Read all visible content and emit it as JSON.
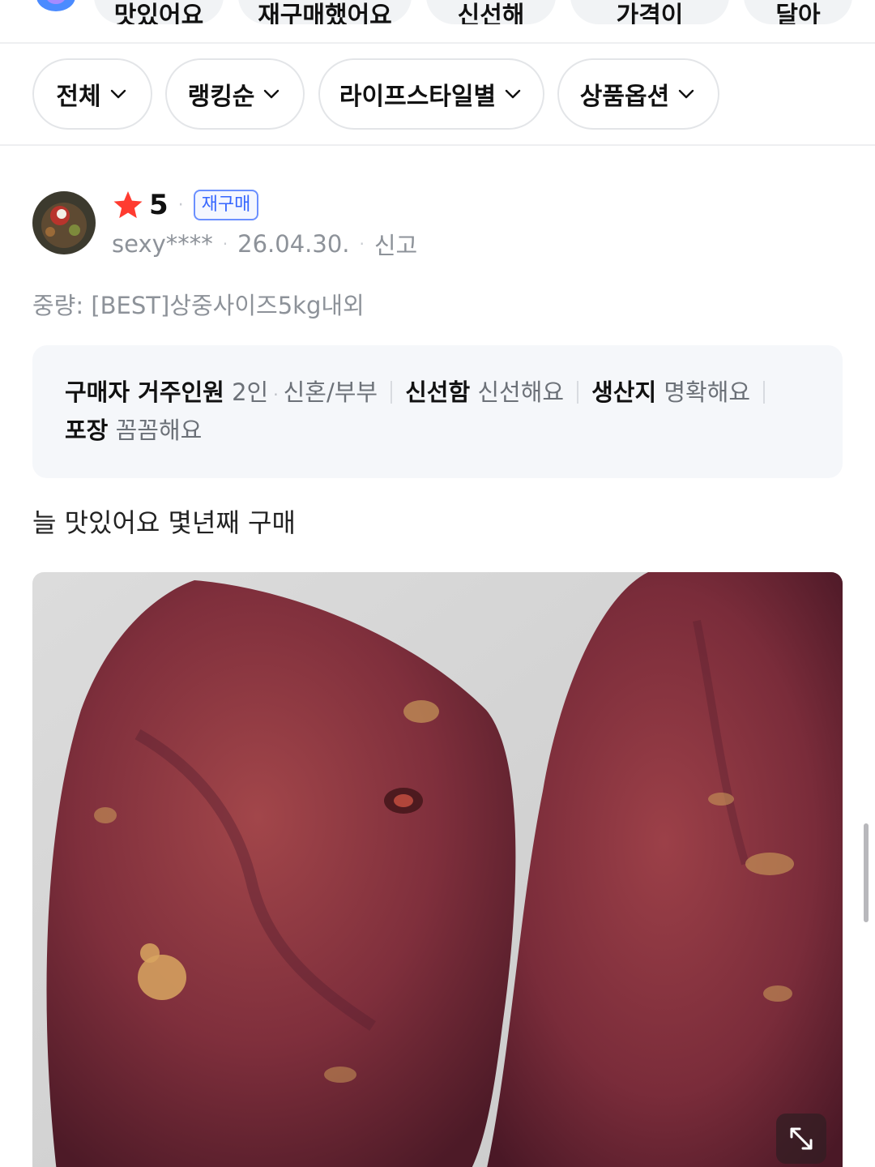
{
  "top_chips": [
    "맛있어요",
    "재구매했어요",
    "신선해",
    "가격이",
    "달아"
  ],
  "filters": [
    {
      "label": "전체"
    },
    {
      "label": "랭킹순"
    },
    {
      "label": "라이프스타일별"
    },
    {
      "label": "상품옵션"
    }
  ],
  "review": {
    "rating": "5",
    "badge": "재구매",
    "user": "sexy****",
    "date": "26.04.30.",
    "report": "신고",
    "option": "중량: [BEST]상중사이즈5kg내외",
    "attributes": {
      "household_label": "구매자 거주인원",
      "household_count": "2인",
      "household_type": "신혼/부부",
      "freshness_label": "신선함",
      "freshness_value": "신선해요",
      "origin_label": "생산지",
      "origin_value": "명확해요",
      "packaging_label": "포장",
      "packaging_value": "꼼꼼해요"
    },
    "text": "늘 맛있어요 몇년째 구매"
  },
  "colors": {
    "star": "#ff3b30",
    "badge_blue": "#3566ff",
    "muted": "#8d9299"
  },
  "icons": [
    "logo-icon",
    "chevron-down-icon",
    "star-icon",
    "expand-icon"
  ]
}
